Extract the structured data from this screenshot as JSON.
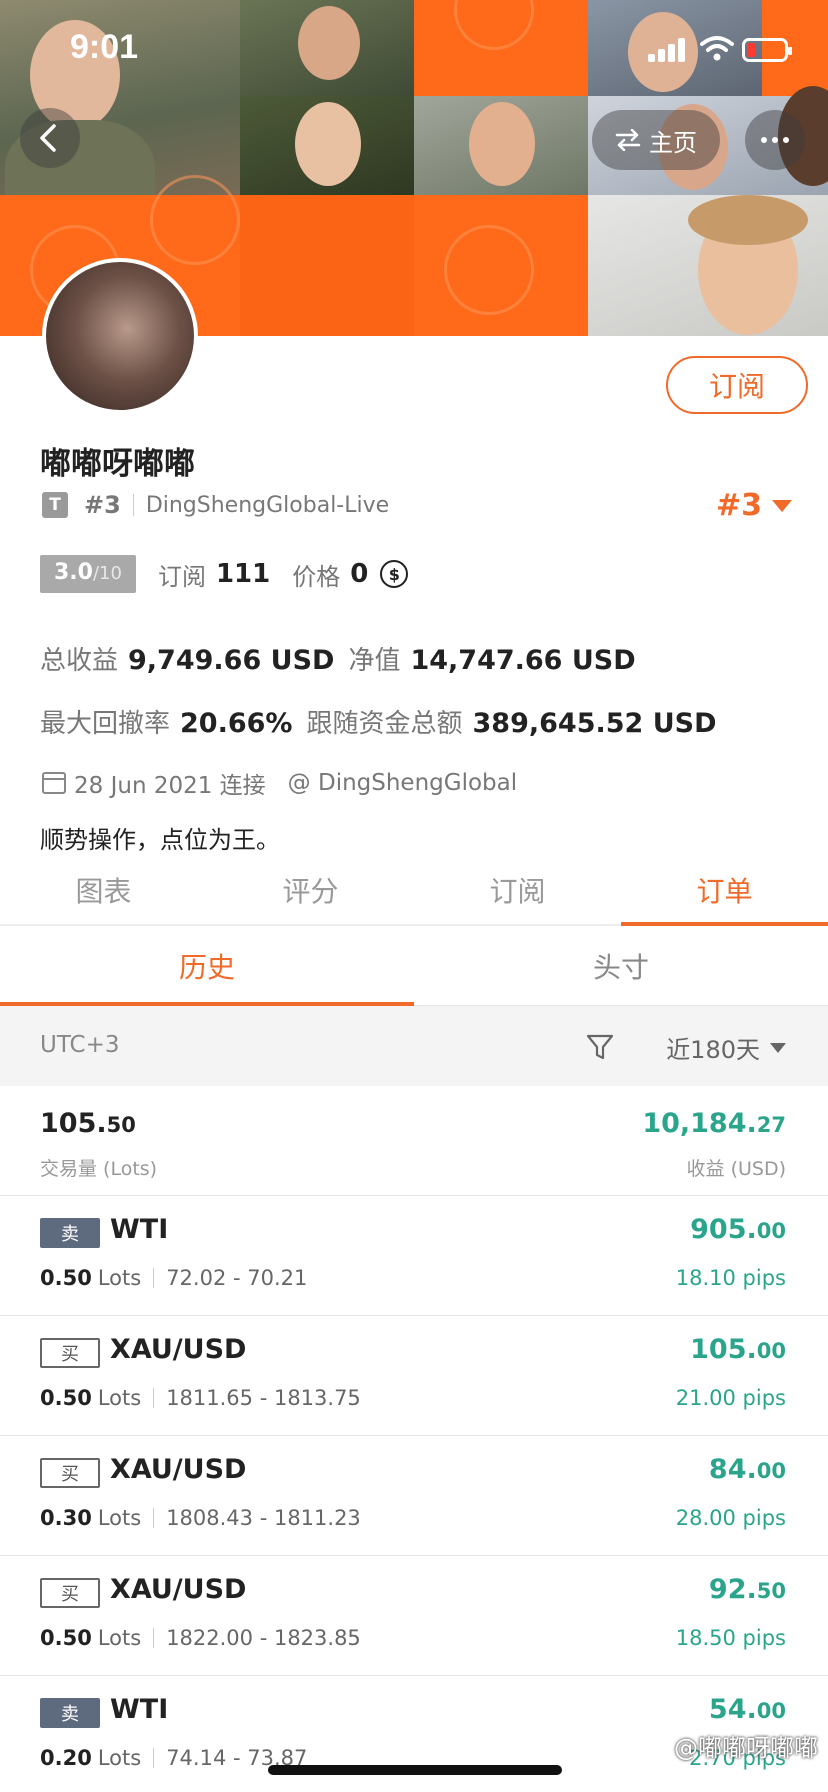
{
  "status": {
    "time": "9:01"
  },
  "header": {
    "home_label": "主页"
  },
  "profile": {
    "subscribe_label": "订阅",
    "name": "嘟嘟呀嘟嘟",
    "badge": "T",
    "rank": "#3",
    "account": "DingShengGlobal-Live",
    "rank_large": "#3",
    "score": "3.0",
    "score_max": "/10",
    "subscribe_count_label": "订阅",
    "subscribe_count": "111",
    "price_label": "价格",
    "price": "0",
    "coin_symbol": "$",
    "total_profit_label": "总收益",
    "total_profit": "9,749.66 USD",
    "equity_label": "净值",
    "equity": "14,747.66 USD",
    "max_drawdown_label": "最大回撤率",
    "max_drawdown": "20.66%",
    "follow_funds_label": "跟随资金总额",
    "follow_funds": "389,645.52 USD",
    "joined": "28 Jun 2021 连接",
    "broker": "@ DingShengGlobal",
    "bio": "顺势操作，点位为王。"
  },
  "tabs": [
    "图表",
    "评分",
    "订阅",
    "订单"
  ],
  "subtabs": [
    "历史",
    "头寸"
  ],
  "filter": {
    "timezone": "UTC+3",
    "period": "近180天"
  },
  "summary": {
    "lots_main": "105.",
    "lots_dec": "50",
    "lots_label": "交易量 (Lots)",
    "profit_main": "10,184.",
    "profit_dec": "27",
    "profit_label": "收益 (USD)"
  },
  "orders": [
    {
      "side": "卖",
      "type": "sell",
      "symbol": "WTI",
      "lots": "0.50",
      "lots_unit": "Lots",
      "range": "72.02 - 70.21",
      "pl_main": "905.",
      "pl_dec": "00",
      "pips": "18.10 pips"
    },
    {
      "side": "买",
      "type": "buy",
      "symbol": "XAU/USD",
      "lots": "0.50",
      "lots_unit": "Lots",
      "range": "1811.65 - 1813.75",
      "pl_main": "105.",
      "pl_dec": "00",
      "pips": "21.00 pips"
    },
    {
      "side": "买",
      "type": "buy",
      "symbol": "XAU/USD",
      "lots": "0.30",
      "lots_unit": "Lots",
      "range": "1808.43 - 1811.23",
      "pl_main": "84.",
      "pl_dec": "00",
      "pips": "28.00 pips"
    },
    {
      "side": "买",
      "type": "buy",
      "symbol": "XAU/USD",
      "lots": "0.50",
      "lots_unit": "Lots",
      "range": "1822.00 - 1823.85",
      "pl_main": "92.",
      "pl_dec": "50",
      "pips": "18.50 pips"
    },
    {
      "side": "卖",
      "type": "sell",
      "symbol": "WTI",
      "lots": "0.20",
      "lots_unit": "Lots",
      "range": "74.14 - 73.87",
      "pl_main": "54.",
      "pl_dec": "00",
      "pips": "2.70 pips"
    }
  ],
  "watermark": "@嘟嘟呀嘟嘟",
  "colors": {
    "accent": "#f06a2a",
    "profit": "#2aa58c",
    "banner_orange": "#ff6a1a"
  }
}
